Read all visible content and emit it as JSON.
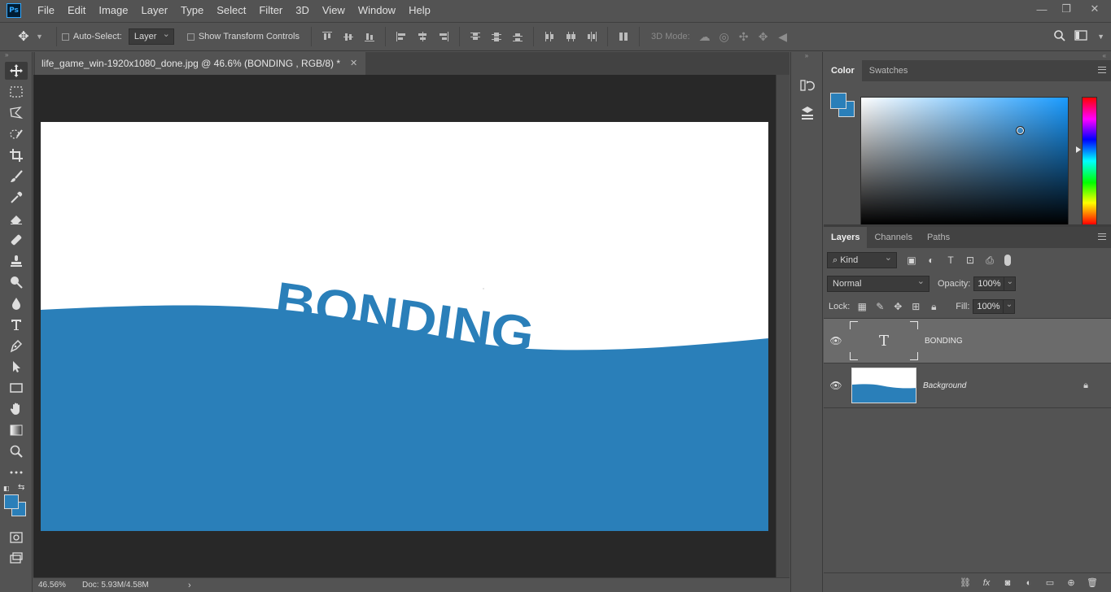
{
  "app": {
    "logo": "Ps",
    "menus": [
      "File",
      "Edit",
      "Image",
      "Layer",
      "Type",
      "Select",
      "Filter",
      "3D",
      "View",
      "Window",
      "Help"
    ]
  },
  "options_bar": {
    "auto_select_label": "Auto-Select:",
    "auto_select_target": "Layer",
    "show_transform_label": "Show Transform Controls",
    "mode_3d_label": "3D Mode:"
  },
  "document": {
    "tab_title": "life_game_win-1920x1080_done.jpg @ 46.6% (BONDING , RGB/8) *",
    "canvas_text": "BONDING",
    "wave_color": "#2a7fb9",
    "canvas_bg": "#ffffff"
  },
  "status": {
    "zoom": "46.56%",
    "doc_size": "Doc: 5.93M/4.58M"
  },
  "color_panel": {
    "tabs": [
      "Color",
      "Swatches"
    ],
    "active_tab": "Color",
    "foreground": "#2a7fb9",
    "background": "#2a7fb9"
  },
  "layers_panel": {
    "tabs": [
      "Layers",
      "Channels",
      "Paths"
    ],
    "active_tab": "Layers",
    "filter_kind": "Kind",
    "blend_mode": "Normal",
    "opacity_label": "Opacity:",
    "opacity": "100%",
    "lock_label": "Lock:",
    "fill_label": "Fill:",
    "fill": "100%",
    "layers": [
      {
        "name": "BONDING",
        "type": "text",
        "visible": true,
        "selected": true
      },
      {
        "name": "Background",
        "type": "image",
        "visible": true,
        "locked": true
      }
    ]
  },
  "icons": {
    "tools": [
      "move-icon",
      "marquee-icon",
      "lasso-icon",
      "quick-select-icon",
      "crop-icon",
      "brush-icon",
      "eyedropper-icon",
      "eraser-icon",
      "healing-icon",
      "stamp-icon",
      "dodge-icon",
      "blur-icon",
      "type-icon",
      "pen-icon",
      "path-select-icon",
      "rectangle-icon",
      "hand-icon",
      "gradient-icon",
      "zoom-icon",
      "more-tools-icon"
    ]
  }
}
